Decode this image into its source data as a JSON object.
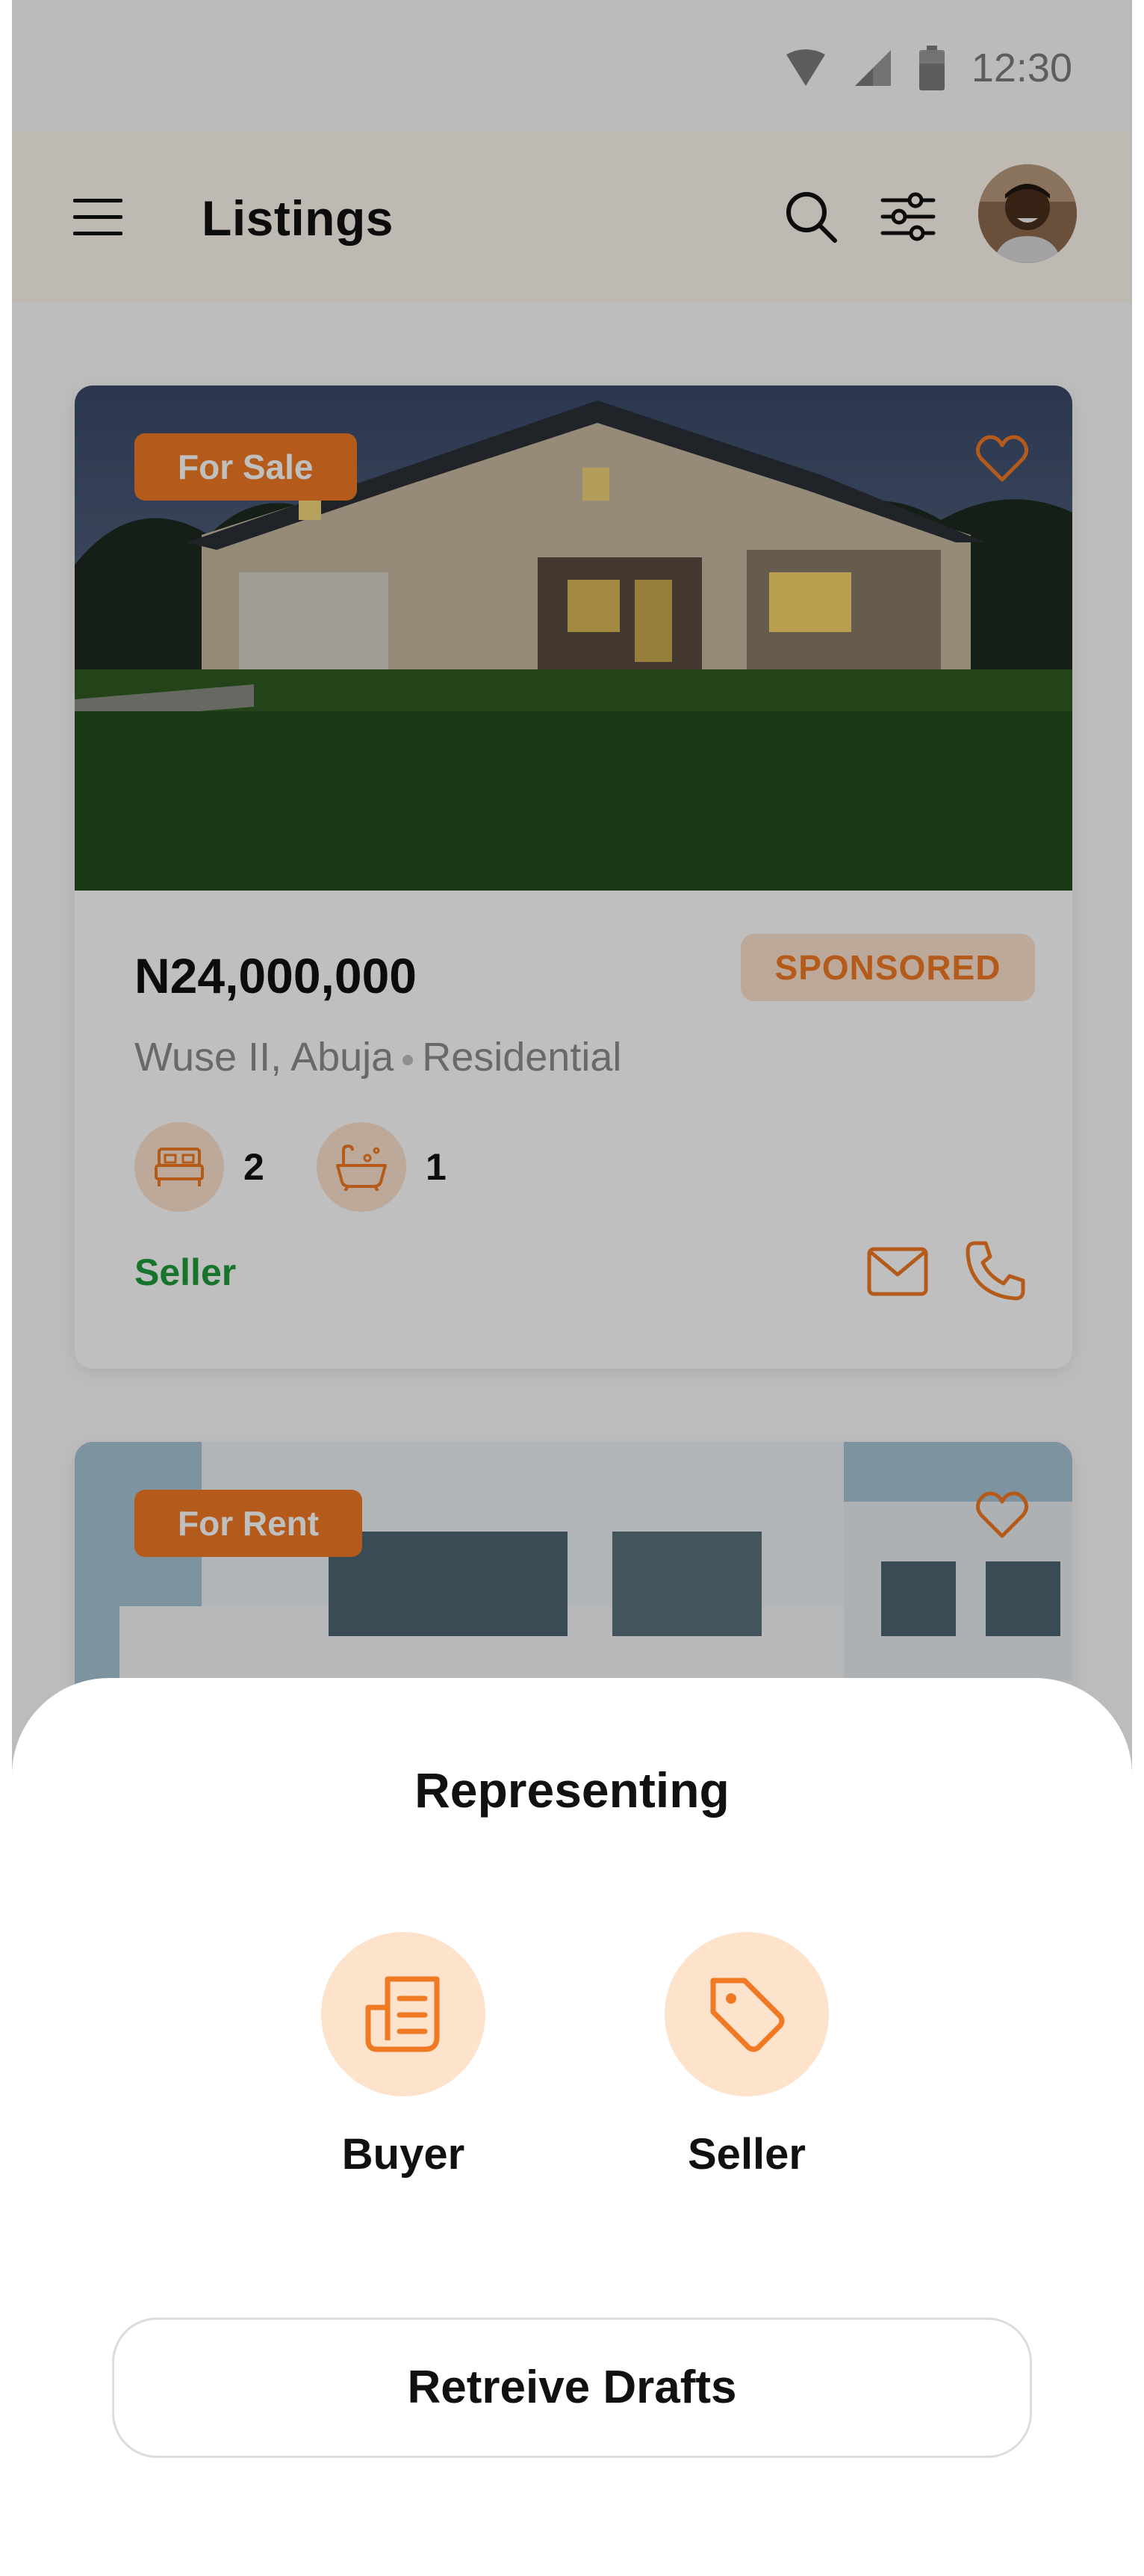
{
  "status_bar": {
    "time": "12:30",
    "icons": [
      "wifi-icon",
      "signal-icon",
      "battery-icon"
    ]
  },
  "app_bar": {
    "title": "Listings",
    "icons": [
      "menu-icon",
      "search-icon",
      "filter-icon",
      "avatar"
    ]
  },
  "listings": [
    {
      "tag": "For Sale",
      "price": "N24,000,000",
      "badge": "SPONSORED",
      "area": "Wuse II, Abuja",
      "type": "Residential",
      "bedrooms": "2",
      "bathrooms": "1",
      "contact_label": "Seller"
    },
    {
      "tag": "For Rent"
    }
  ],
  "sheet": {
    "title": "Representing",
    "options": [
      {
        "label": "Buyer",
        "icon": "document-icon"
      },
      {
        "label": "Seller",
        "icon": "tag-icon"
      }
    ],
    "button_label": "Retreive Drafts"
  },
  "colors": {
    "accent": "#f07a24",
    "accent_light": "#fde2cc",
    "app_bar_bg": "#fff7ef",
    "seller_green": "#1e9b3c",
    "overlay": "rgba(0,0,0,0.25)"
  }
}
